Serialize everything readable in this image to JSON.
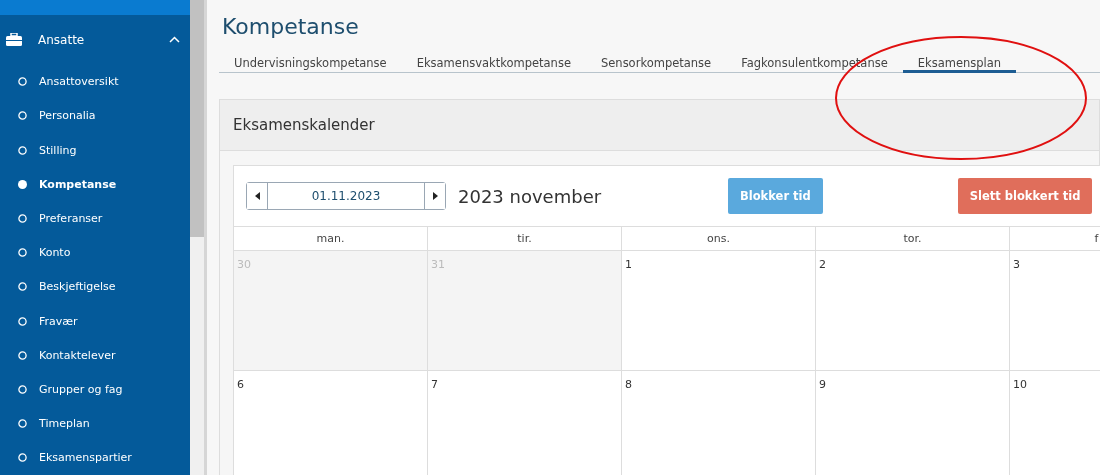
{
  "sidebar": {
    "group": {
      "label": "Ansatte",
      "expanded": true
    },
    "items": [
      {
        "label": "Ansattoversikt",
        "selected": false
      },
      {
        "label": "Personalia",
        "selected": false
      },
      {
        "label": "Stilling",
        "selected": false
      },
      {
        "label": "Kompetanse",
        "selected": true
      },
      {
        "label": "Preferanser",
        "selected": false
      },
      {
        "label": "Konto",
        "selected": false
      },
      {
        "label": "Beskjeftigelse",
        "selected": false
      },
      {
        "label": "Fravær",
        "selected": false
      },
      {
        "label": "Kontaktelever",
        "selected": false
      },
      {
        "label": "Grupper og fag",
        "selected": false
      },
      {
        "label": "Timeplan",
        "selected": false
      },
      {
        "label": "Eksamenspartier",
        "selected": false
      }
    ]
  },
  "page_title": "Kompetanse",
  "tabs": [
    {
      "label": "Undervisningskompetanse",
      "selected": false
    },
    {
      "label": "Eksamensvaktkompetanse",
      "selected": false
    },
    {
      "label": "Sensorkompetanse",
      "selected": false
    },
    {
      "label": "Fagkonsulentkompetanse",
      "selected": false
    },
    {
      "label": "Eksamensplan",
      "selected": true
    }
  ],
  "annotations": [
    {
      "kind": "ellipse"
    }
  ],
  "card": {
    "title": "Eksamenskalender",
    "date_field": {
      "value": "01.11.2023"
    },
    "month_label": "2023 november",
    "buttons": [
      {
        "label": "Blokker tid",
        "kind": "primary"
      },
      {
        "label": "Slett blokkert tid",
        "kind": "danger"
      }
    ],
    "weekdays": [
      "man.",
      "tir.",
      "ons.",
      "tor.",
      "f"
    ],
    "weeks": [
      {
        "days": [
          {
            "label": "30",
            "other_month": true
          },
          {
            "label": "31",
            "other_month": true
          },
          {
            "label": "1",
            "other_month": false
          },
          {
            "label": "2",
            "other_month": false
          },
          {
            "label": "3",
            "other_month": false
          }
        ]
      },
      {
        "days": [
          {
            "label": "6",
            "other_month": false
          },
          {
            "label": "7",
            "other_month": false
          },
          {
            "label": "8",
            "other_month": false
          },
          {
            "label": "9",
            "other_month": false
          },
          {
            "label": "10",
            "other_month": false
          }
        ]
      }
    ]
  }
}
